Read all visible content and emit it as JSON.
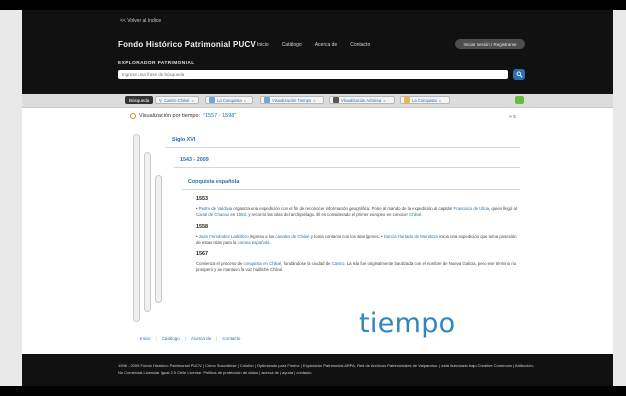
{
  "header": {
    "back_link": "<< Volver al índice",
    "site_title": "Fondo Histórico Patrimonial PUCV",
    "nav": [
      "Inicio",
      "Catálogo",
      "Acerca de",
      "Contacto"
    ],
    "login_label": "Iniciar sesión / Registrarse",
    "explorer_label": "EXPLORADOR PATRIMONIAL",
    "search_placeholder": "Ingrese una frase de búsqueda"
  },
  "toolbar": {
    "busqueda_label": "Búsqueda",
    "tabs": [
      {
        "label": "Castro Chiloé",
        "icon": "search-icon"
      },
      {
        "label": "La Conquista",
        "icon": "window-icon"
      },
      {
        "label": "Visualización Tiempo",
        "icon": "window-icon"
      },
      {
        "label": "Visualización Arbórea",
        "icon": "tree-icon"
      },
      {
        "label": "La Conquista",
        "icon": "folder-icon"
      }
    ]
  },
  "visualization": {
    "title_prefix": "Visualización por tiempo:",
    "range": "\"1557 - 1598\"",
    "tools": "» ≡"
  },
  "timeline": {
    "century": "Siglo XVI",
    "period": "1543 - 2009",
    "topic": "Conquista española",
    "events": [
      {
        "year": "1553",
        "text_parts": [
          {
            "t": "• ",
            "link": false
          },
          {
            "t": "Pedro de Valdivia",
            "link": true
          },
          {
            "t": " organiza una expedición con el fin de reconocer información geográfica. Pone al mando de la expedición al capitán ",
            "link": false
          },
          {
            "t": "Francisco de Ulloa",
            "link": true
          },
          {
            "t": ", quien llegó al ",
            "link": false
          },
          {
            "t": "Canal de Chacao",
            "link": true
          },
          {
            "t": " en ",
            "link": false
          },
          {
            "t": "1553",
            "link": true
          },
          {
            "t": ", y recorrió las islas del archipiélago. Él es considerado el primer europeo en conocer ",
            "link": false
          },
          {
            "t": "Chiloé",
            "link": true
          },
          {
            "t": ".",
            "link": false
          }
        ]
      },
      {
        "year": "1558",
        "text_parts": [
          {
            "t": "• ",
            "link": false
          },
          {
            "t": "Juan Fernández Ladrillero",
            "link": true
          },
          {
            "t": " ingresa a los ",
            "link": false
          },
          {
            "t": "canales de Chiloé",
            "link": true
          },
          {
            "t": " y toma contacto con los aborígenes. • ",
            "link": false
          },
          {
            "t": "García Hurtado de Mendoza",
            "link": true
          },
          {
            "t": " inicia una expedición que toma posesión de estas islas para la ",
            "link": false
          },
          {
            "t": "corona española",
            "link": true
          },
          {
            "t": ".",
            "link": false
          }
        ]
      },
      {
        "year": "1567",
        "text_parts": [
          {
            "t": "Comienza el proceso de ",
            "link": false
          },
          {
            "t": "conquista en Chiloé",
            "link": true
          },
          {
            "t": ", fundándose la ciudad de ",
            "link": false
          },
          {
            "t": "Castro",
            "link": true
          },
          {
            "t": ". La isla fue originalmente bautizada con el nombre de Nueva Galicia, pero ese término no prosperó y se mantuvo la voz huilliche Chiloé.",
            "link": false
          }
        ]
      }
    ]
  },
  "footer_links": [
    "Inicio",
    "Catálogo",
    "Acerca de",
    "Contacto"
  ],
  "brand_word": "tiempo",
  "credits": "1998 - 2009 Fondo Histórico Patrimonial PUCV | Cómo Suscribirse | Colofón | Optimizado para Firefox | Explorador Patrimonial ARPA, Red de Archivos Patrimoniales de Valparaíso. | está licenciado bajo Creative Commons | Atribución-No Comercial-Licenciar Igual 2.0 Chile License. Política de protección de datos | acerca de | ayuda | contacto",
  "colors": {
    "accent": "#2b6fb3",
    "brand": "#2f86bf",
    "header_bg": "#111111",
    "clock": "#e0892a",
    "green_tool": "#6cbb3c"
  }
}
